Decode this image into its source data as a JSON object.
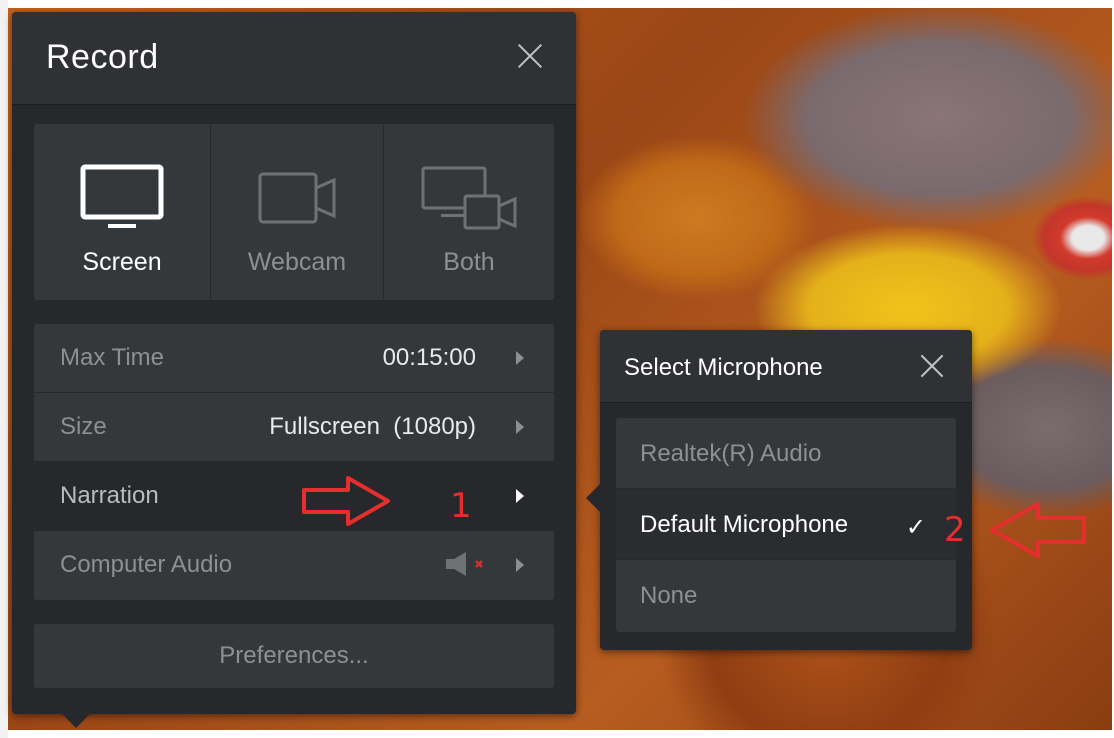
{
  "record": {
    "title": "Record",
    "modes": [
      {
        "label": "Screen",
        "icon": "monitor-icon",
        "active": true
      },
      {
        "label": "Webcam",
        "icon": "camera-icon",
        "active": false
      },
      {
        "label": "Both",
        "icon": "monitor-camera-icon",
        "active": false
      }
    ],
    "settings": {
      "max_time": {
        "label": "Max Time",
        "value": "00:15:00"
      },
      "size": {
        "label": "Size",
        "value": "Fullscreen  (1080p)"
      },
      "narration": {
        "label": "Narration"
      },
      "computer_audio": {
        "label": "Computer Audio",
        "icon": "speaker-muted-icon"
      }
    },
    "preferences_label": "Preferences..."
  },
  "microphone": {
    "title": "Select Microphone",
    "options": [
      {
        "label": "Realtek(R) Audio",
        "selected": false
      },
      {
        "label": "Default Microphone",
        "selected": true
      },
      {
        "label": "None",
        "selected": false
      }
    ],
    "check_glyph": "✓"
  },
  "annotations": {
    "step1": "1",
    "step2": "2",
    "color": "#e62e2e"
  }
}
